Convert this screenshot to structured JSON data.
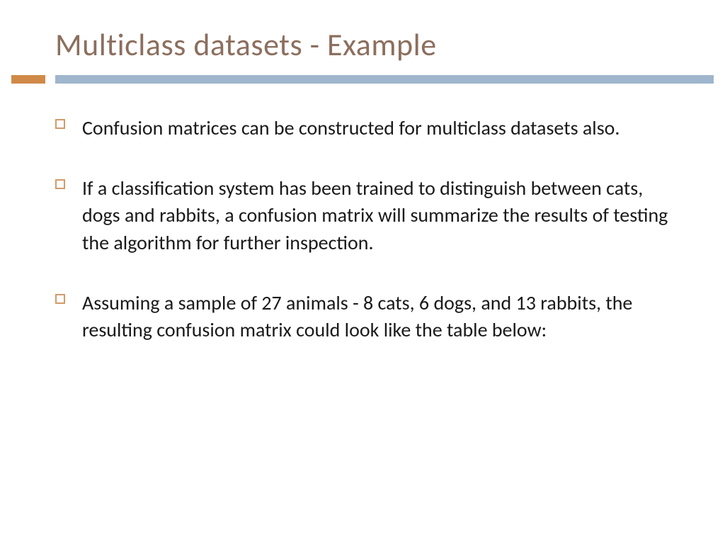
{
  "slide": {
    "title": "Multiclass datasets - Example",
    "bullets": [
      "Confusion matrices can be constructed for multiclass datasets also.",
      "If a classification system has been trained to distinguish between cats, dogs and rabbits, a confusion matrix will summarize the results of testing the algorithm for further inspection.",
      "Assuming a sample of 27 animals - 8 cats, 6 dogs, and 13 rabbits, the resulting confusion matrix could look like the table below:"
    ]
  }
}
